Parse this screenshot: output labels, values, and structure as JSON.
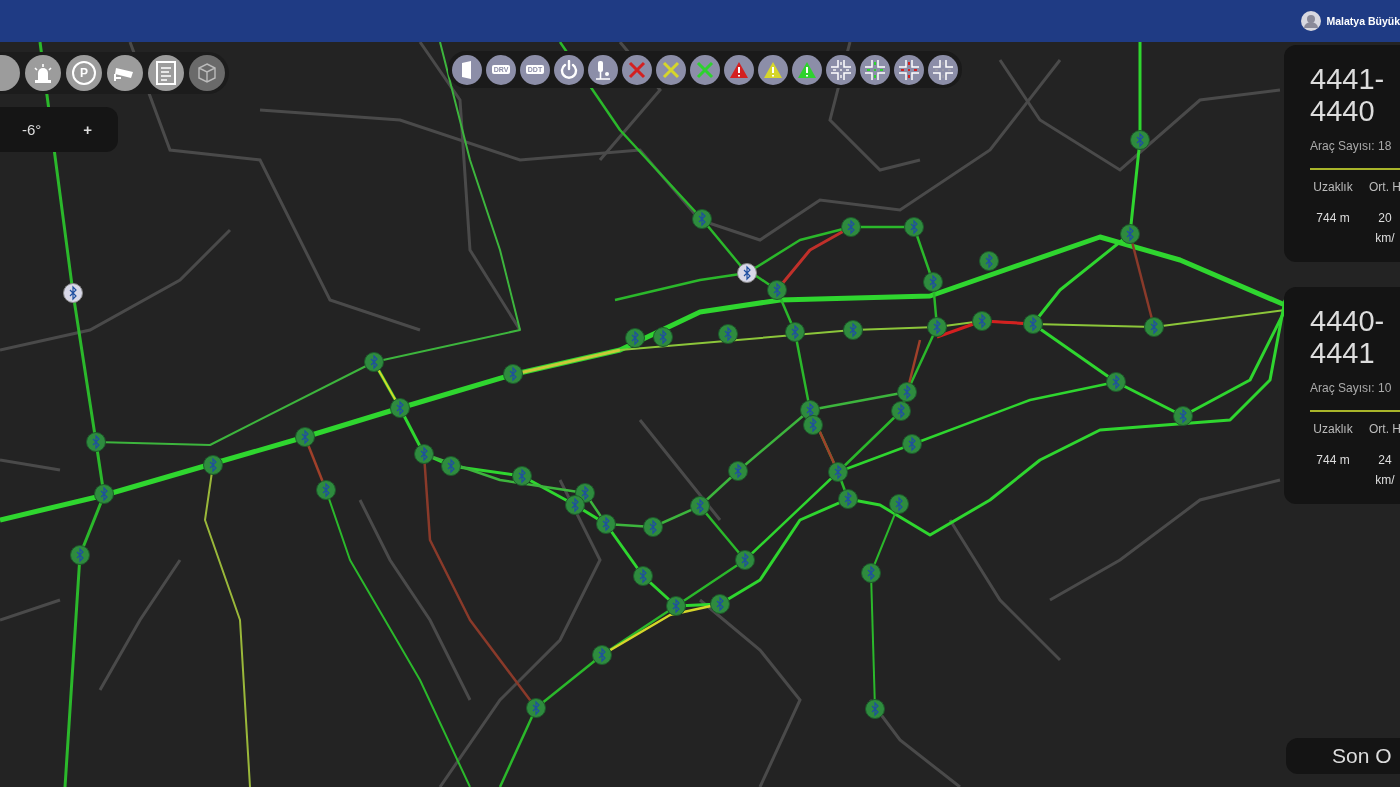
{
  "top_bar": {
    "user_name": "Malatya Büyük"
  },
  "left_toolbar": [
    {
      "kind": "blank"
    },
    {
      "kind": "siren"
    },
    {
      "kind": "label",
      "label": "P"
    },
    {
      "kind": "camera"
    },
    {
      "kind": "document"
    },
    {
      "kind": "cube",
      "disabled": true
    }
  ],
  "compass": {
    "angle": "-6°",
    "zoom_in": "+"
  },
  "center_toolbar": [
    {
      "kind": "door"
    },
    {
      "kind": "label",
      "label": "DRV"
    },
    {
      "kind": "label",
      "label": "DDT"
    },
    {
      "kind": "power"
    },
    {
      "kind": "signal"
    },
    {
      "kind": "cross",
      "color": "#d42020"
    },
    {
      "kind": "cross",
      "color": "#d6d62a"
    },
    {
      "kind": "cross",
      "color": "#2ed22e"
    },
    {
      "kind": "warning",
      "color": "#d42020"
    },
    {
      "kind": "warning",
      "color": "#d6d62a"
    },
    {
      "kind": "warning",
      "color": "#2ed22e"
    },
    {
      "kind": "junction",
      "color": "#d8d8e0"
    },
    {
      "kind": "junction",
      "color": "#2ed22e"
    },
    {
      "kind": "junction",
      "color": "#d42020"
    },
    {
      "kind": "junction",
      "color": "#9a9aa8"
    }
  ],
  "route_cards": [
    {
      "title": "4441-4440",
      "vehicle_count": "Araç Sayısı: 18",
      "stats": [
        {
          "label": "Uzaklık",
          "value": "744 m"
        },
        {
          "label": "Ort. H",
          "value": "20 km/"
        }
      ]
    },
    {
      "title": "4440-4441",
      "vehicle_count": "Araç Sayısı: 10",
      "stats": [
        {
          "label": "Uzaklık",
          "value": "744 m"
        },
        {
          "label": "Ort. H",
          "value": "24 km/"
        }
      ]
    }
  ],
  "bottom_card": {
    "title": "Son O"
  }
}
